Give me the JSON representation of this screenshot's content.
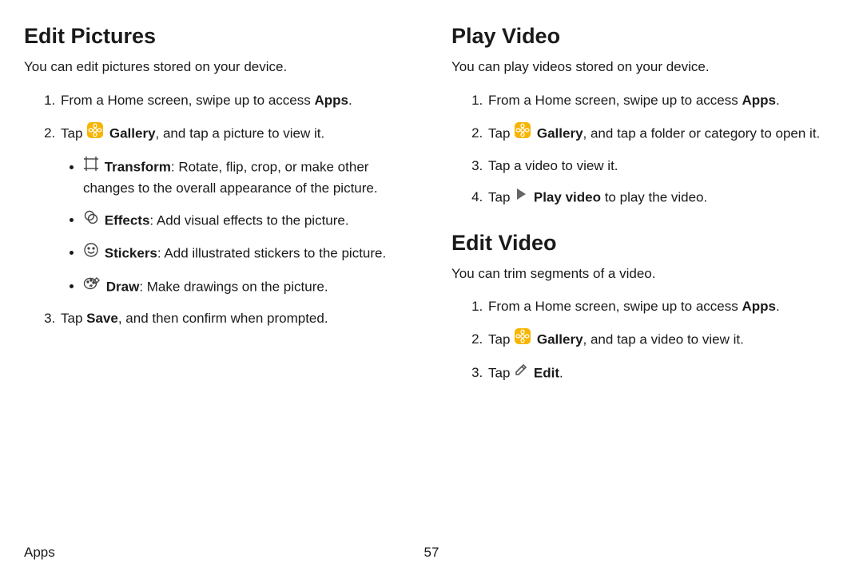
{
  "left": {
    "heading": "Edit Pictures",
    "intro": "You can edit pictures stored on your device.",
    "steps": {
      "s1_a": "From a Home screen, swipe up to access ",
      "s1_b": "Apps",
      "s1_c": ".",
      "s2_a": "Tap ",
      "s2_b": "Gallery",
      "s2_c": ", and tap a picture to view it.",
      "s3_a": "Tap ",
      "s3_b": "Save",
      "s3_c": ", and then confirm when prompted."
    },
    "bullets": {
      "b1_a": "Transform",
      "b1_b": ": Rotate, flip, crop, or make other changes to the overall appearance of the picture.",
      "b2_a": "Effects",
      "b2_b": ": Add visual effects to the picture.",
      "b3_a": "Stickers",
      "b3_b": ": Add illustrated stickers to the picture.",
      "b4_a": "Draw",
      "b4_b": ": Make drawings on the picture."
    }
  },
  "right1": {
    "heading": "Play Video",
    "intro": "You can play videos stored on your device.",
    "steps": {
      "s1_a": "From a Home screen, swipe up to access ",
      "s1_b": "Apps",
      "s1_c": ".",
      "s2_a": "Tap ",
      "s2_b": "Gallery",
      "s2_c": ", and tap a folder or category to open it.",
      "s3": "Tap a video to view it.",
      "s4_a": "Tap ",
      "s4_b": "Play video",
      "s4_c": " to play the video."
    }
  },
  "right2": {
    "heading": "Edit Video",
    "intro": "You can trim segments of a video.",
    "steps": {
      "s1_a": "From a Home screen, swipe up to access ",
      "s1_b": "Apps",
      "s1_c": ".",
      "s2_a": "Tap ",
      "s2_b": "Gallery",
      "s2_c": ", and tap a video to view it.",
      "s3_a": "Tap ",
      "s3_b": "Edit",
      "s3_c": "."
    }
  },
  "footer": {
    "section": "Apps",
    "page": "57"
  },
  "icons": {
    "gallery": "gallery-icon",
    "transform": "transform-icon",
    "effects": "effects-icon",
    "stickers": "stickers-icon",
    "draw": "draw-icon",
    "play": "play-icon",
    "edit": "edit-icon"
  }
}
